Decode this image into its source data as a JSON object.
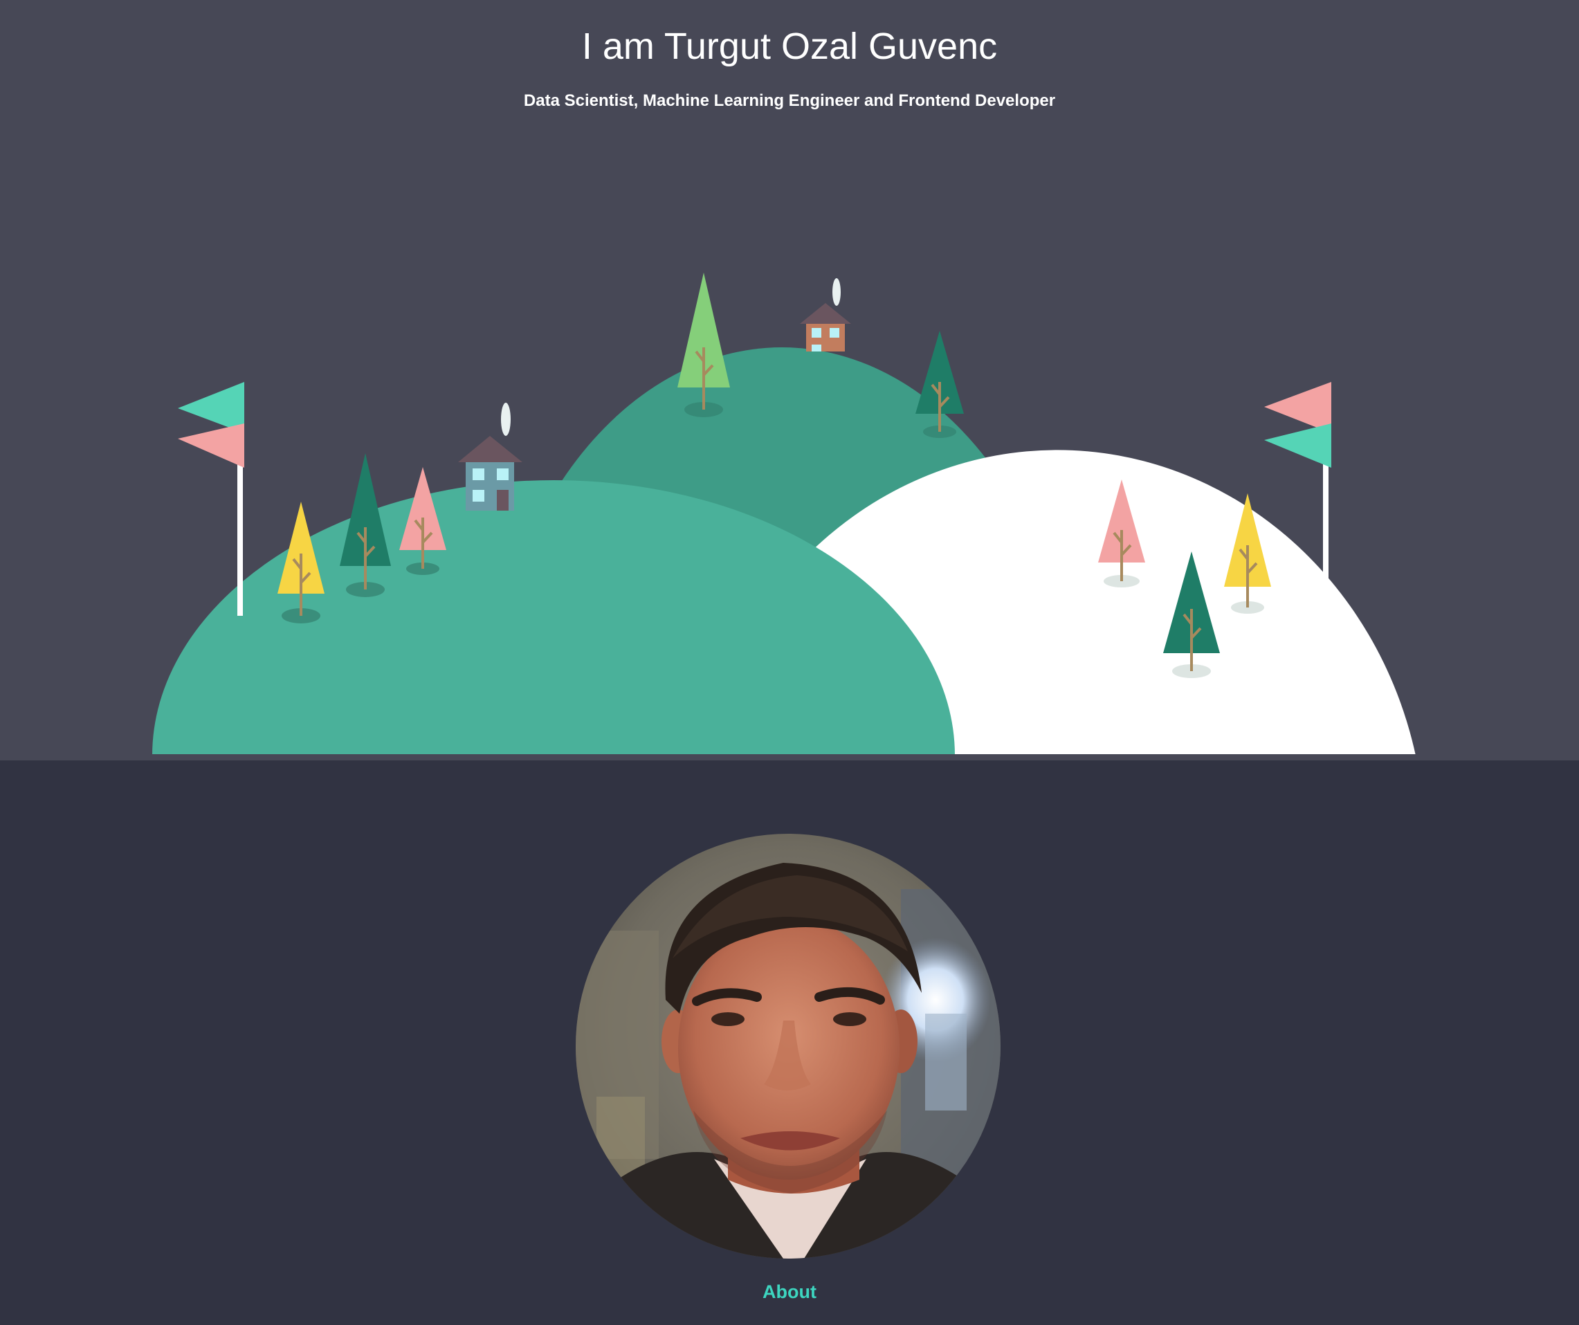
{
  "hero": {
    "title": "I am Turgut Ozal Guvenc",
    "subtitle": "Data Scientist, Machine Learning Engineer and Frontend Developer"
  },
  "colors": {
    "hero_background": "#474856",
    "page_background": "#313342",
    "hill_front": "#4ab19a",
    "hill_back": "#3e9c87",
    "hill_snow": "#ffffff",
    "accent_link": "#3dd6c0",
    "tree_dark": "#1f7d67",
    "tree_light": "#85cf7a",
    "tree_pink": "#f3a3a3",
    "tree_yellow": "#f7d544",
    "flag_teal": "#55d4b6",
    "flag_pink": "#f3a3a3"
  },
  "profile": {
    "avatar_alt": "Portrait photo of Turgut Ozal Guvenc"
  },
  "nav": {
    "about_label": "About"
  }
}
